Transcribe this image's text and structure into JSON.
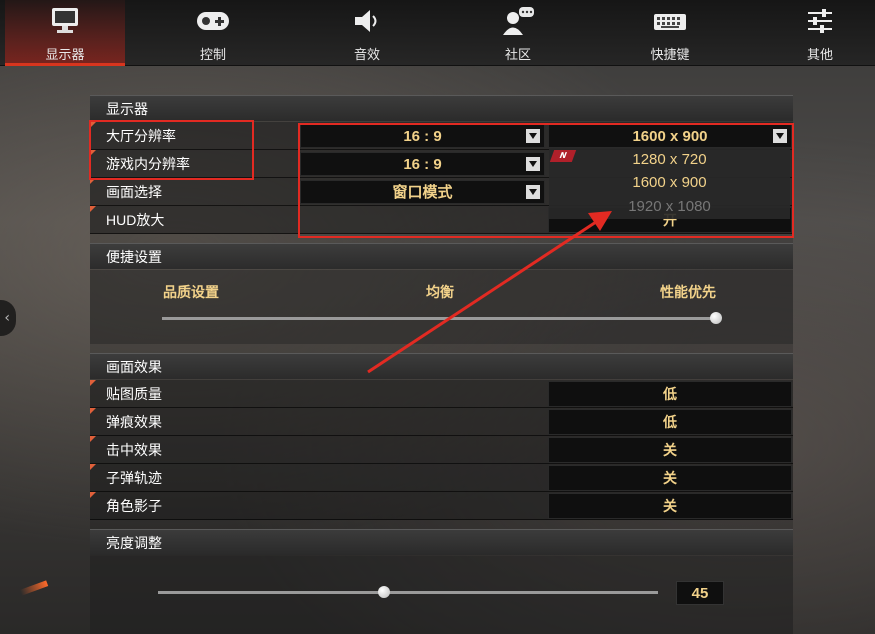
{
  "nav": {
    "tabs": [
      {
        "label": "显示器",
        "icon": "monitor-icon"
      },
      {
        "label": "控制",
        "icon": "gamepad-icon"
      },
      {
        "label": "音效",
        "icon": "speaker-icon"
      },
      {
        "label": "社区",
        "icon": "community-icon"
      },
      {
        "label": "快捷键",
        "icon": "keyboard-icon"
      },
      {
        "label": "其他",
        "icon": "sliders-icon"
      }
    ],
    "active_tab": "显示器"
  },
  "display": {
    "title": "显示器",
    "rows": [
      {
        "label": "大厅分辨率",
        "ratio": "16 : 9",
        "resolution": "1600 x 900"
      },
      {
        "label": "游戏内分辨率",
        "ratio": "16 : 9"
      },
      {
        "label": "画面选择",
        "mode": "窗口模式"
      },
      {
        "label": "HUD放大",
        "value": "开"
      }
    ],
    "resolution_options": [
      {
        "label": "1280 x 720",
        "enabled": true
      },
      {
        "label": "1600 x 900",
        "enabled": true
      },
      {
        "label": "1920 x 1080",
        "enabled": false
      }
    ],
    "new_badge": "N"
  },
  "quick": {
    "title": "便捷设置",
    "labels": [
      "品质设置",
      "均衡",
      "性能优先"
    ],
    "position": 1.0
  },
  "effects": {
    "title": "画面效果",
    "rows": [
      {
        "label": "贴图质量",
        "value": "低"
      },
      {
        "label": "弹痕效果",
        "value": "低"
      },
      {
        "label": "击中效果",
        "value": "关"
      },
      {
        "label": "子弹轨迹",
        "value": "关"
      },
      {
        "label": "角色影子",
        "value": "关"
      }
    ]
  },
  "brightness": {
    "title": "亮度调整",
    "value": "45"
  },
  "colors": {
    "accent_red": "#d8351e",
    "value_gold": "#f2d28a",
    "annotation_red": "#e22a22"
  }
}
